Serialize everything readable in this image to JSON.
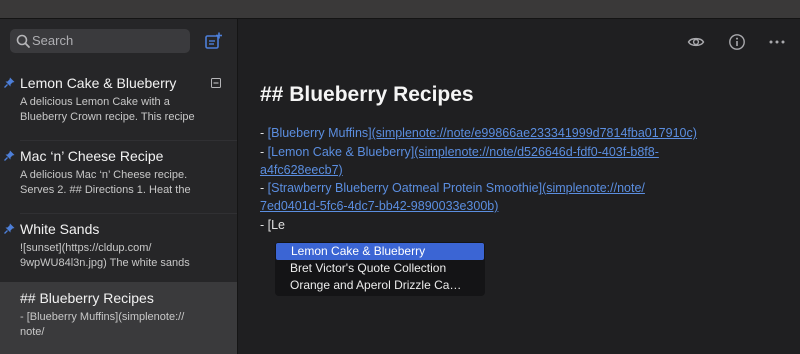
{
  "search": {
    "placeholder": "Search"
  },
  "notes": [
    {
      "title": "Lemon Cake & Blueberry",
      "excerpt": [
        "A delicious Lemon Cake with a",
        "Blueberry Crown recipe. This recipe"
      ]
    },
    {
      "title": "Mac ‘n’ Cheese Recipe",
      "excerpt": [
        "A delicious Mac ‘n’ Cheese recipe.",
        "Serves 2. ## Directions 1. Heat the"
      ]
    },
    {
      "title": "White Sands",
      "excerpt": [
        "![sunset](https://cldup.com/",
        "9wpWU84l3n.jpg) The white sands"
      ]
    },
    {
      "title": "## Blueberry Recipes",
      "excerpt": [
        "- [Blueberry Muffins](simplenote://",
        "note/"
      ]
    }
  ],
  "editor": {
    "heading": "## Blueberry Recipes",
    "lines": [
      {
        "dash": "- ",
        "text": "[Blueberry Muffins]",
        "url": "(simplenote://note/e99866ae233341999d7814fba017910c)"
      },
      {
        "dash": "- ",
        "text": "[Lemon Cake & Blueberry]",
        "url": "(simplenote://note/d526646d-fdf0-403f-b8f8-",
        "url_cont": "a4fc628eecb7)"
      },
      {
        "dash": "- ",
        "text": "[Strawberry Blueberry Oatmeal Protein Smoothie]",
        "url": "(simplenote://note/",
        "url_cont": "7ed0401d-5fc6-4dc7-bb42-9890033e300b)"
      },
      {
        "typing": "- [Le"
      }
    ]
  },
  "autocomplete": [
    "Lemon Cake & Blueberry",
    "Bret Victor's Quote Collection",
    "Orange and Aperol Drizzle Ca…"
  ],
  "colors": {
    "accent": "#3b65d4",
    "link": "#5b8ee0",
    "pin": "#4d7fd9"
  },
  "icons": [
    "search-icon",
    "new-note-icon",
    "pin-icon",
    "checklist-icon",
    "preview-eye-icon",
    "info-icon",
    "more-icon"
  ]
}
